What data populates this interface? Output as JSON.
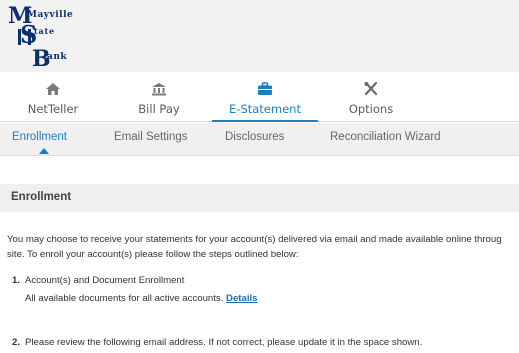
{
  "brand": {
    "name": "Mayville State Bank",
    "logo_line1": "Mayville",
    "logo_line2": "tate",
    "logo_line3": "ank",
    "logo_initial_m": "M",
    "logo_initial_s": "S",
    "logo_initial_b": "B",
    "logo_color": "#0d2f6e"
  },
  "main_nav": {
    "items": [
      {
        "label": "NetTeller",
        "icon": "home-icon"
      },
      {
        "label": "Bill Pay",
        "icon": "bank-icon"
      },
      {
        "label": "E-Statement",
        "icon": "briefcase-icon",
        "active": true
      },
      {
        "label": "Options",
        "icon": "tools-icon"
      }
    ],
    "accent_color": "#1a7fc1"
  },
  "sub_nav": {
    "items": [
      {
        "label": "Enrollment",
        "active": true
      },
      {
        "label": "Email Settings"
      },
      {
        "label": "Disclosures"
      },
      {
        "label": "Reconciliation Wizard"
      }
    ]
  },
  "section": {
    "title": "Enrollment"
  },
  "content": {
    "intro_line1": "You may choose to receive your statements for your account(s) delivered via email and made available online throug",
    "intro_line2": "site. To enroll your account(s) please follow the steps outlined below:",
    "steps": [
      {
        "number": "1.",
        "text": "Account(s) and Document Enrollment",
        "sub_text": "All available documents for all active accounts.",
        "link": "Details"
      },
      {
        "number": "2.",
        "text": "Please review the following email address. If not correct, please update it in the space shown."
      }
    ]
  }
}
